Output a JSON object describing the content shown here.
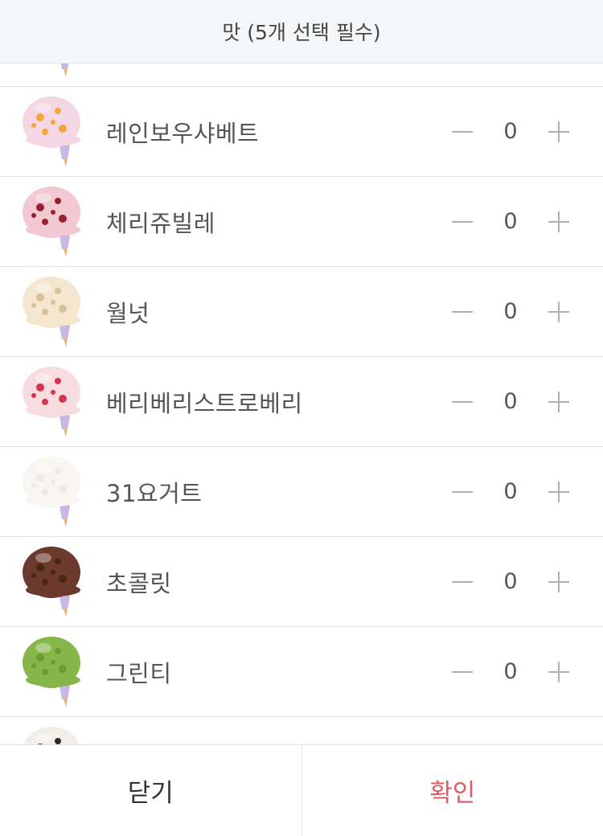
{
  "header": {
    "title": "맛 (5개 선택 필수)"
  },
  "flavors": [
    {
      "name": "",
      "qty": "",
      "icon": "ice-cream-scoop-icon",
      "color": "#e8a3b8",
      "spots": "#c84468",
      "partial": true
    },
    {
      "name": "레인보우샤베트",
      "qty": "0",
      "icon": "ice-cream-scoop-icon",
      "color": "#f4d6e4",
      "spots": "#f2a73a"
    },
    {
      "name": "체리쥬빌레",
      "qty": "0",
      "icon": "ice-cream-scoop-icon",
      "color": "#f2c8d2",
      "spots": "#9a2030"
    },
    {
      "name": "월넛",
      "qty": "0",
      "icon": "ice-cream-scoop-icon",
      "color": "#f4e6cf",
      "spots": "#d8c09a"
    },
    {
      "name": "베리베리스트로베리",
      "qty": "0",
      "icon": "ice-cream-scoop-icon",
      "color": "#f7dde0",
      "spots": "#d2364e"
    },
    {
      "name": "31요거트",
      "qty": "0",
      "icon": "ice-cream-scoop-icon",
      "color": "#f8f6f1",
      "spots": "#eeeae0"
    },
    {
      "name": "초콜릿",
      "qty": "0",
      "icon": "ice-cream-scoop-icon",
      "color": "#6b3a2c",
      "spots": "#4a2519"
    },
    {
      "name": "그린티",
      "qty": "0",
      "icon": "ice-cream-scoop-icon",
      "color": "#86b64a",
      "spots": "#6c9a36"
    },
    {
      "name": "",
      "qty": "",
      "icon": "ice-cream-scoop-icon",
      "color": "#f2efe8",
      "spots": "#2a2a2a",
      "partial": true
    }
  ],
  "footer": {
    "close_label": "닫기",
    "confirm_label": "확인"
  },
  "colors": {
    "accent": "#e05b63",
    "header_bg": "#f5f6f8",
    "cone": "#e7b277",
    "cone_wrap": "#c9b7e6"
  }
}
